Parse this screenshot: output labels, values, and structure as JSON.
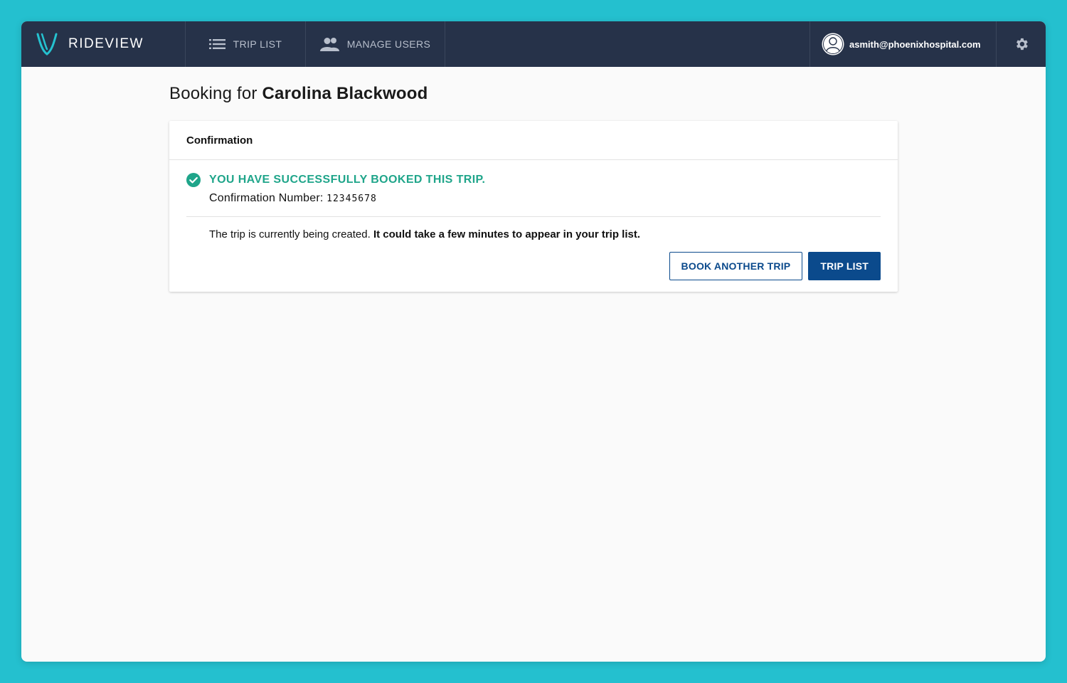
{
  "header": {
    "brand": "RIDEVIEW",
    "nav": [
      {
        "label": "TRIP LIST",
        "icon": "list-icon"
      },
      {
        "label": "MANAGE USERS",
        "icon": "people-icon"
      }
    ],
    "user_email": "asmith@phoenixhospital.com"
  },
  "page": {
    "title_prefix": "Booking for",
    "patient_name": "Carolina Blackwood"
  },
  "card": {
    "title": "Confirmation",
    "success_message": "YOU HAVE SUCCESSFULLY BOOKED THIS TRIP.",
    "confirmation_label": "Confirmation Number:",
    "confirmation_number": "12345678",
    "note_plain": "The trip is currently being created.",
    "note_bold": "It could take a few minutes to appear in your trip list.",
    "buttons": {
      "book_another": "BOOK ANOTHER TRIP",
      "trip_list": "TRIP LIST"
    }
  },
  "colors": {
    "topbar": "#263249",
    "background": "#24c0cf",
    "success": "#1fa58a",
    "primary": "#0b4a8c"
  }
}
